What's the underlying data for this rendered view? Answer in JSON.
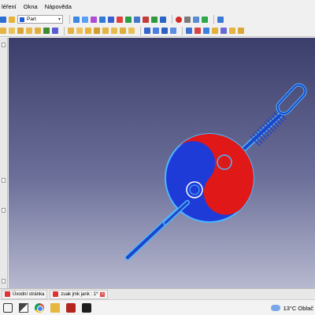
{
  "menu": [
    "léření",
    "Okna",
    "Nápověda"
  ],
  "toolbar": {
    "workbench": "Part"
  },
  "doc_tabs": [
    {
      "label": "Úvodní stránka"
    },
    {
      "label": "zuak jmk jank : 1*"
    }
  ],
  "tray": {
    "weather": "13°C  Oblač"
  },
  "colors": {
    "viewport_top": "#3b3e6a",
    "viewport_bottom": "#b7b9cf",
    "model_blue": "#1e3bd8",
    "model_red": "#e01818",
    "outline": "#4db7ff"
  }
}
